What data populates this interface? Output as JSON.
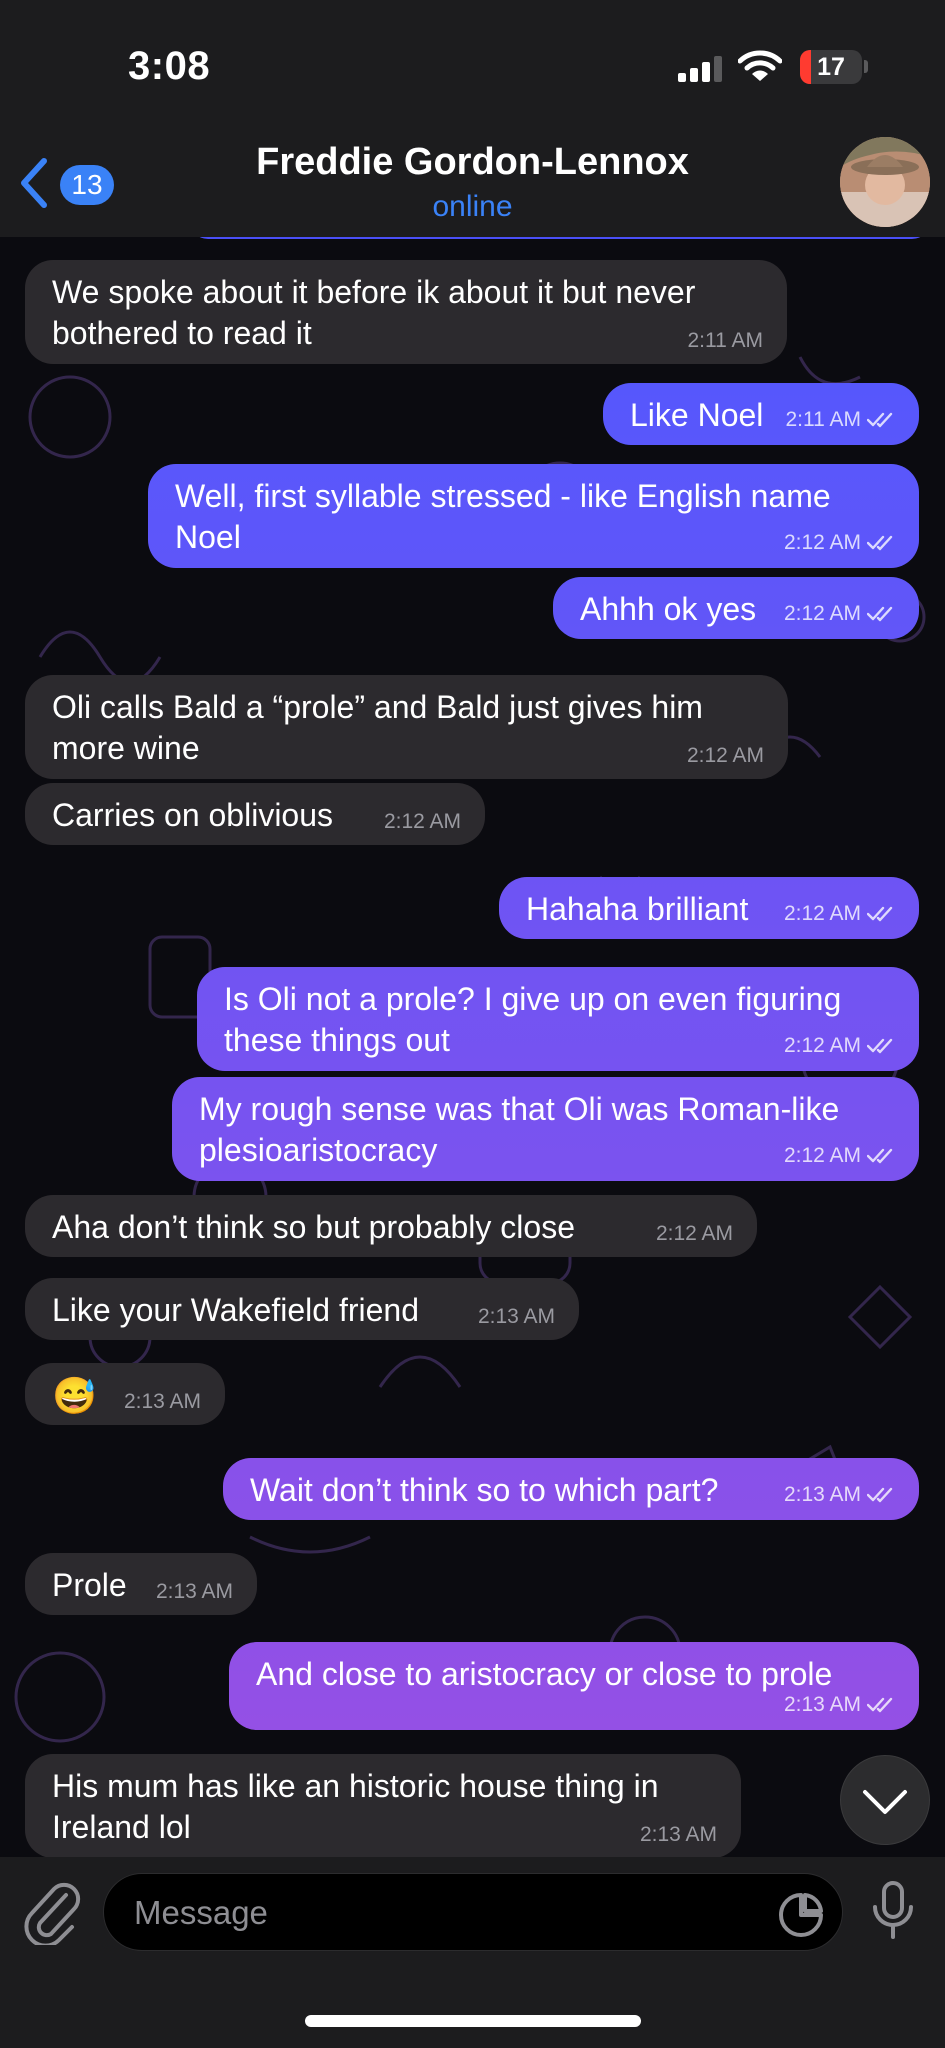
{
  "status_bar": {
    "time": "3:08",
    "battery": "17",
    "battery_level": 0.17
  },
  "header": {
    "back_count": "13",
    "contact_name": "Freddie Gordon-Lennox",
    "status": "online"
  },
  "colors": {
    "accent": "#3a82f7",
    "incoming_bubble": "#2c2a2e",
    "outgoing_bubble_top": "#4f58ff",
    "outgoing_bubble_bottom": "#9a4fe3"
  },
  "messages": [
    {
      "direction": "incoming",
      "text": "We spoke about it before ik about it but never bothered to read it",
      "time": "2:11 AM"
    },
    {
      "direction": "outgoing",
      "text": "Like Noel",
      "time": "2:11 AM",
      "read": true
    },
    {
      "direction": "outgoing",
      "text": "Well, first syllable stressed - like English name Noel",
      "time": "2:12 AM",
      "read": true
    },
    {
      "direction": "outgoing",
      "text": "Ahhh ok yes",
      "time": "2:12 AM",
      "read": true
    },
    {
      "direction": "incoming",
      "text": "Oli calls Bald a “prole” and Bald just gives him more wine",
      "time": "2:12 AM"
    },
    {
      "direction": "incoming",
      "text": "Carries on oblivious",
      "time": "2:12 AM"
    },
    {
      "direction": "outgoing",
      "text": "Hahaha brilliant",
      "time": "2:12 AM",
      "read": true
    },
    {
      "direction": "outgoing",
      "text": "Is Oli not a prole? I give up on even figuring these things out",
      "time": "2:12 AM",
      "read": true
    },
    {
      "direction": "outgoing",
      "text": "My rough sense was that Oli was Roman-like plesioaristocracy",
      "time": "2:12 AM",
      "read": true
    },
    {
      "direction": "incoming",
      "text": "Aha don’t think so but probably close",
      "time": "2:12 AM"
    },
    {
      "direction": "incoming",
      "text": "Like your Wakefield friend",
      "time": "2:13 AM"
    },
    {
      "direction": "incoming",
      "text": "😅",
      "time": "2:13 AM"
    },
    {
      "direction": "outgoing",
      "text": "Wait don’t think so to which part?",
      "time": "2:13 AM",
      "read": true
    },
    {
      "direction": "incoming",
      "text": "Prole",
      "time": "2:13 AM"
    },
    {
      "direction": "outgoing",
      "text": "And close to aristocracy or close to prole",
      "time": "2:13 AM",
      "read": true
    },
    {
      "direction": "incoming",
      "text": "His mum has like an historic house thing in Ireland lol",
      "time": "2:13 AM"
    }
  ],
  "composer": {
    "placeholder": "Message"
  },
  "icons": [
    "back-chevron-icon",
    "signal-icon",
    "wifi-icon",
    "battery-icon",
    "paperclip-icon",
    "sticker-icon",
    "microphone-icon",
    "chevron-down-icon",
    "double-check-icon"
  ]
}
